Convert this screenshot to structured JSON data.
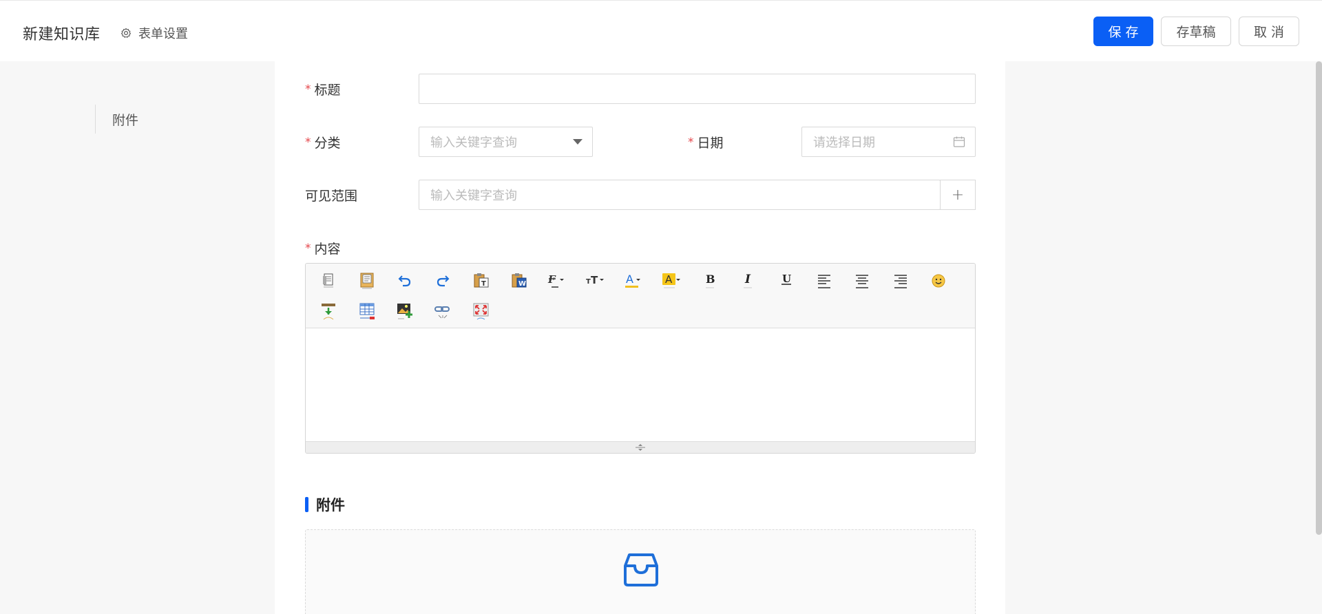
{
  "header": {
    "title": "新建知识库",
    "form_settings_label": "表单设置",
    "buttons": {
      "save": "保 存",
      "draft": "存草稿",
      "cancel": "取 消"
    }
  },
  "anchor_nav": {
    "items": [
      {
        "label": "附件"
      }
    ]
  },
  "form": {
    "title_field": {
      "label": "标题",
      "required": true,
      "value": "",
      "placeholder": ""
    },
    "category_field": {
      "label": "分类",
      "required": true,
      "placeholder": "输入关键字查询"
    },
    "date_field": {
      "label": "日期",
      "required": true,
      "placeholder": "请选择日期"
    },
    "visibility_field": {
      "label": "可见范围",
      "required": false,
      "placeholder": "输入关键字查询",
      "add_symbol": "+"
    },
    "content_field": {
      "label": "内容",
      "required": true
    }
  },
  "editor": {
    "toolbar_row1": [
      "source-icon",
      "template-icon",
      "undo-icon",
      "redo-icon",
      "paste-text-icon",
      "paste-word-icon",
      "font-family-icon",
      "font-size-icon",
      "font-color-icon",
      "highlight-color-icon",
      "bold-icon",
      "italic-icon",
      "underline-icon",
      "align-left-icon",
      "align-center-icon",
      "align-right-icon",
      "emoji-icon"
    ],
    "toolbar_row2": [
      "insert-row-icon",
      "table-icon",
      "image-icon",
      "link-icon",
      "fullscreen-icon"
    ],
    "bold_glyph": "B",
    "italic_glyph": "I",
    "underline_glyph": "U",
    "font_color_glyph": "A",
    "highlight_glyph": "A",
    "font_size_glyph": "тT"
  },
  "attachments": {
    "section_title": "附件",
    "dropzone_icon": "inbox-icon"
  },
  "colors": {
    "primary": "#0a5ff5",
    "required": "#e5484d",
    "border": "#d9d9d9",
    "page_bg": "#f7f7f7"
  }
}
